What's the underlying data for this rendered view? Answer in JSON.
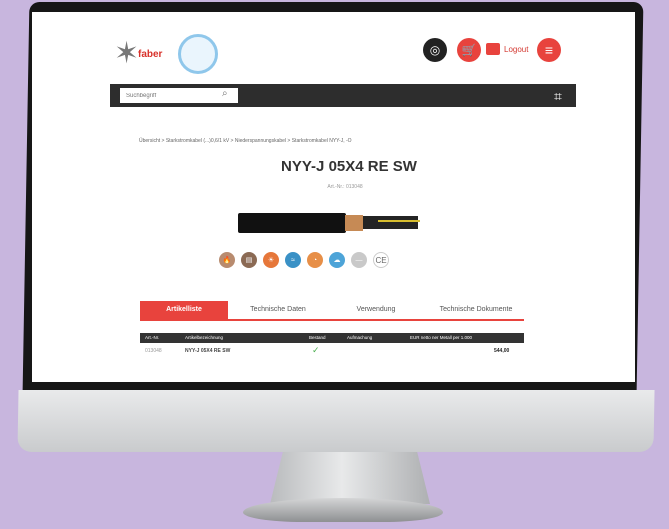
{
  "header": {
    "logo_text": "faber",
    "logout_label": "Logout",
    "icons": [
      "globe-icon",
      "cart-icon",
      "logout-icon",
      "menu-icon"
    ]
  },
  "search": {
    "placeholder": "Suchbegriff"
  },
  "breadcrumb": "Übersicht > Starkstromkabel (...)0,6/1 kV > Niederspannungskabel > Starkstromkabel NYY-J, -O",
  "product": {
    "title": "NYY-J 05X4 RE SW",
    "article": "Art.-Nr.: 013048",
    "property_icons": [
      "fire-icon",
      "soil-icon",
      "temperature-icon",
      "water-icon",
      "installation-icon",
      "outdoor-icon",
      "flexible-icon",
      "ce-icon"
    ],
    "ce_text": "CE"
  },
  "tabs": [
    {
      "label": "Artikelliste",
      "active": true
    },
    {
      "label": "Technische Daten",
      "active": false
    },
    {
      "label": "Verwendung",
      "active": false
    },
    {
      "label": "Technische Dokumente",
      "active": false
    }
  ],
  "table": {
    "headers": [
      "Art.-Nr.",
      "Artikelbezeichnung",
      "Bestand",
      "Aufmachung",
      "EUR netto ner Metall per 1.000"
    ],
    "rows": [
      {
        "article": "013048",
        "name": "NYY-J 05X4 RE SW",
        "stock": "✓",
        "packaging": "",
        "price": "544,00"
      }
    ]
  },
  "colors": {
    "accent": "#e8433d",
    "dark_bar": "#2d2d2d",
    "background": "#c8b6de"
  }
}
